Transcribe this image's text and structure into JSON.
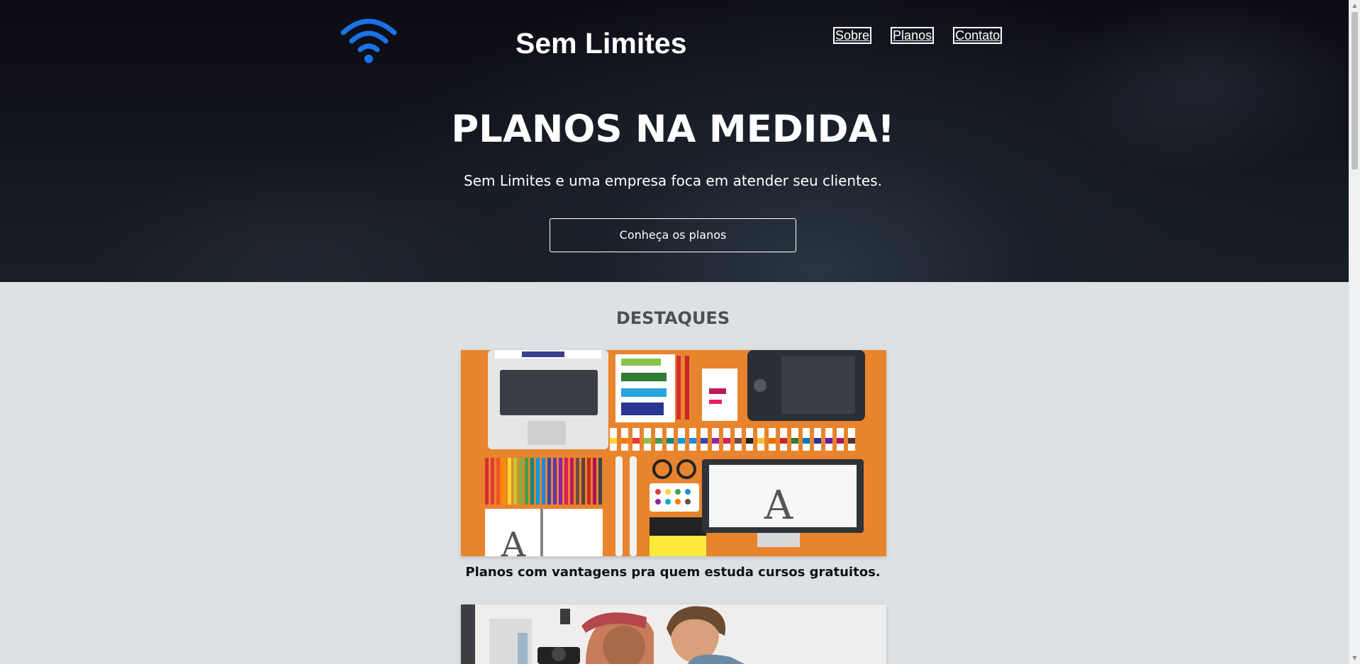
{
  "header": {
    "brand": "Sem Limites",
    "logo_icon": "wifi-icon",
    "logo_color": "#1a73e8",
    "nav": [
      {
        "label": "Sobre"
      },
      {
        "label": "Planos"
      },
      {
        "label": "Contato"
      }
    ]
  },
  "hero": {
    "title": "PLANOS NA MEDIDA!",
    "subtitle": "Sem Limites e uma empresa foca em atender seu clientes.",
    "cta_label": "Conheça os planos"
  },
  "features": {
    "title": "DESTAQUES",
    "items": [
      {
        "caption": "Planos com vantagens pra quem estuda cursos gratuitos.",
        "image": "designer-desk-flatlay-image"
      },
      {
        "caption": "",
        "image": "students-with-camera-image"
      }
    ]
  },
  "colors": {
    "hero_bg": "#0f0f17",
    "page_bg": "#dee1e4",
    "section_title": "#505050",
    "accent_orange": "#e8842d"
  }
}
